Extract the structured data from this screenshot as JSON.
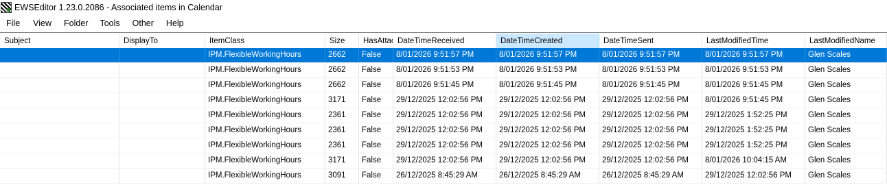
{
  "window": {
    "title": "EWSEditor 1.23.0.2086 - Associated items in Calendar",
    "icon": "ews-app-icon"
  },
  "menu": [
    "File",
    "View",
    "Folder",
    "Tools",
    "Other",
    "Help"
  ],
  "table": {
    "columns": [
      "Subject",
      "DisplayTo",
      "ItemClass",
      "Size",
      "HasAttac",
      "DateTimeReceived",
      "DateTimeCreated",
      "DateTimeSent",
      "LastModifiedTime",
      "LastModifiedName"
    ],
    "sorted_column": "DateTimeCreated",
    "selected_row": 0,
    "rows": [
      [
        "",
        "",
        "IPM.FlexibleWorkingHours",
        "2662",
        "False",
        "8/01/2026 9:51:57 PM",
        "8/01/2026 9:51:57 PM",
        "8/01/2026 9:51:57 PM",
        "8/01/2026 9:51:57 PM",
        "Glen Scales"
      ],
      [
        "",
        "",
        "IPM.FlexibleWorkingHours",
        "2662",
        "False",
        "8/01/2026 9:51:53 PM",
        "8/01/2026 9:51:53 PM",
        "8/01/2026 9:51:53 PM",
        "8/01/2026 9:51:53 PM",
        "Glen Scales"
      ],
      [
        "",
        "",
        "IPM.FlexibleWorkingHours",
        "2662",
        "False",
        "8/01/2026 9:51:45 PM",
        "8/01/2026 9:51:45 PM",
        "8/01/2026 9:51:45 PM",
        "8/01/2026 9:51:45 PM",
        "Glen Scales"
      ],
      [
        "",
        "",
        "IPM.FlexibleWorkingHours",
        "3171",
        "False",
        "29/12/2025 12:02:56 PM",
        "29/12/2025 12:02:56 PM",
        "29/12/2025 12:02:56 PM",
        "8/01/2026 9:51:45 PM",
        "Glen Scales"
      ],
      [
        "",
        "",
        "IPM.FlexibleWorkingHours",
        "2361",
        "False",
        "29/12/2025 12:02:56 PM",
        "29/12/2025 12:02:56 PM",
        "29/12/2025 12:02:56 PM",
        "29/12/2025 1:52:25 PM",
        "Glen Scales"
      ],
      [
        "",
        "",
        "IPM.FlexibleWorkingHours",
        "2361",
        "False",
        "29/12/2025 12:02:56 PM",
        "29/12/2025 12:02:56 PM",
        "29/12/2025 12:02:56 PM",
        "29/12/2025 1:52:25 PM",
        "Glen Scales"
      ],
      [
        "",
        "",
        "IPM.FlexibleWorkingHours",
        "2361",
        "False",
        "29/12/2025 12:02:56 PM",
        "29/12/2025 12:02:56 PM",
        "29/12/2025 12:02:56 PM",
        "29/12/2025 1:52:25 PM",
        "Glen Scales"
      ],
      [
        "",
        "",
        "IPM.FlexibleWorkingHours",
        "3171",
        "False",
        "29/12/2025 12:02:56 PM",
        "29/12/2025 12:02:56 PM",
        "29/12/2025 12:02:56 PM",
        "8/01/2026 10:04:15 AM",
        "Glen Scales"
      ],
      [
        "",
        "",
        "IPM.FlexibleWorkingHours",
        "3091",
        "False",
        "26/12/2025 8:45:29 AM",
        "26/12/2025 8:45:29 AM",
        "26/12/2025 8:45:29 AM",
        "29/12/2025 12:02:56 PM",
        "Glen Scales"
      ]
    ]
  }
}
